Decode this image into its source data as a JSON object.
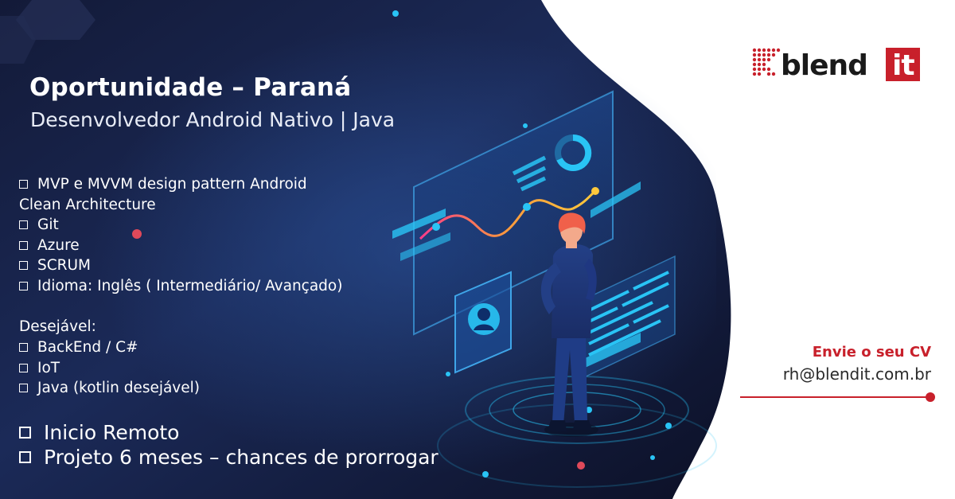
{
  "colors": {
    "background_dark": "#10162e",
    "background_mid": "#1c2c5c",
    "accent_red": "#c8202b",
    "accent_cyan": "#29c4f5",
    "white": "#ffffff"
  },
  "header": {
    "title": "Oportunidade – Paraná",
    "subtitle": "Desenvolvedor Android Nativo | Java"
  },
  "requirements": [
    {
      "text": "MVP e MVVM design pattern Android",
      "checkbox": true
    },
    {
      "text": "Clean Architecture",
      "checkbox": false
    },
    {
      "text": "Git",
      "checkbox": true
    },
    {
      "text": "Azure",
      "checkbox": true
    },
    {
      "text": "SCRUM",
      "checkbox": true
    },
    {
      "text": "Idioma: Inglês ( Intermediário/ Avançado)",
      "checkbox": true
    }
  ],
  "desirable": {
    "heading": "Desejável:",
    "items": [
      {
        "text": "BackEnd / C#"
      },
      {
        "text": "IoT"
      },
      {
        "text": "Java (kotlin desejável)"
      }
    ]
  },
  "conditions": [
    {
      "text": "Inicio Remoto"
    },
    {
      "text": "Projeto 6 meses – chances de prorrogar"
    }
  ],
  "logo": {
    "word": "blend",
    "badge": "it"
  },
  "contact": {
    "label": "Envie o seu CV",
    "email": "rh@blendit.com.br"
  },
  "icons": [
    "checkbox-icon",
    "logo-dots-icon",
    "user-profile-icon",
    "donut-chart-icon",
    "developer-illustration"
  ]
}
